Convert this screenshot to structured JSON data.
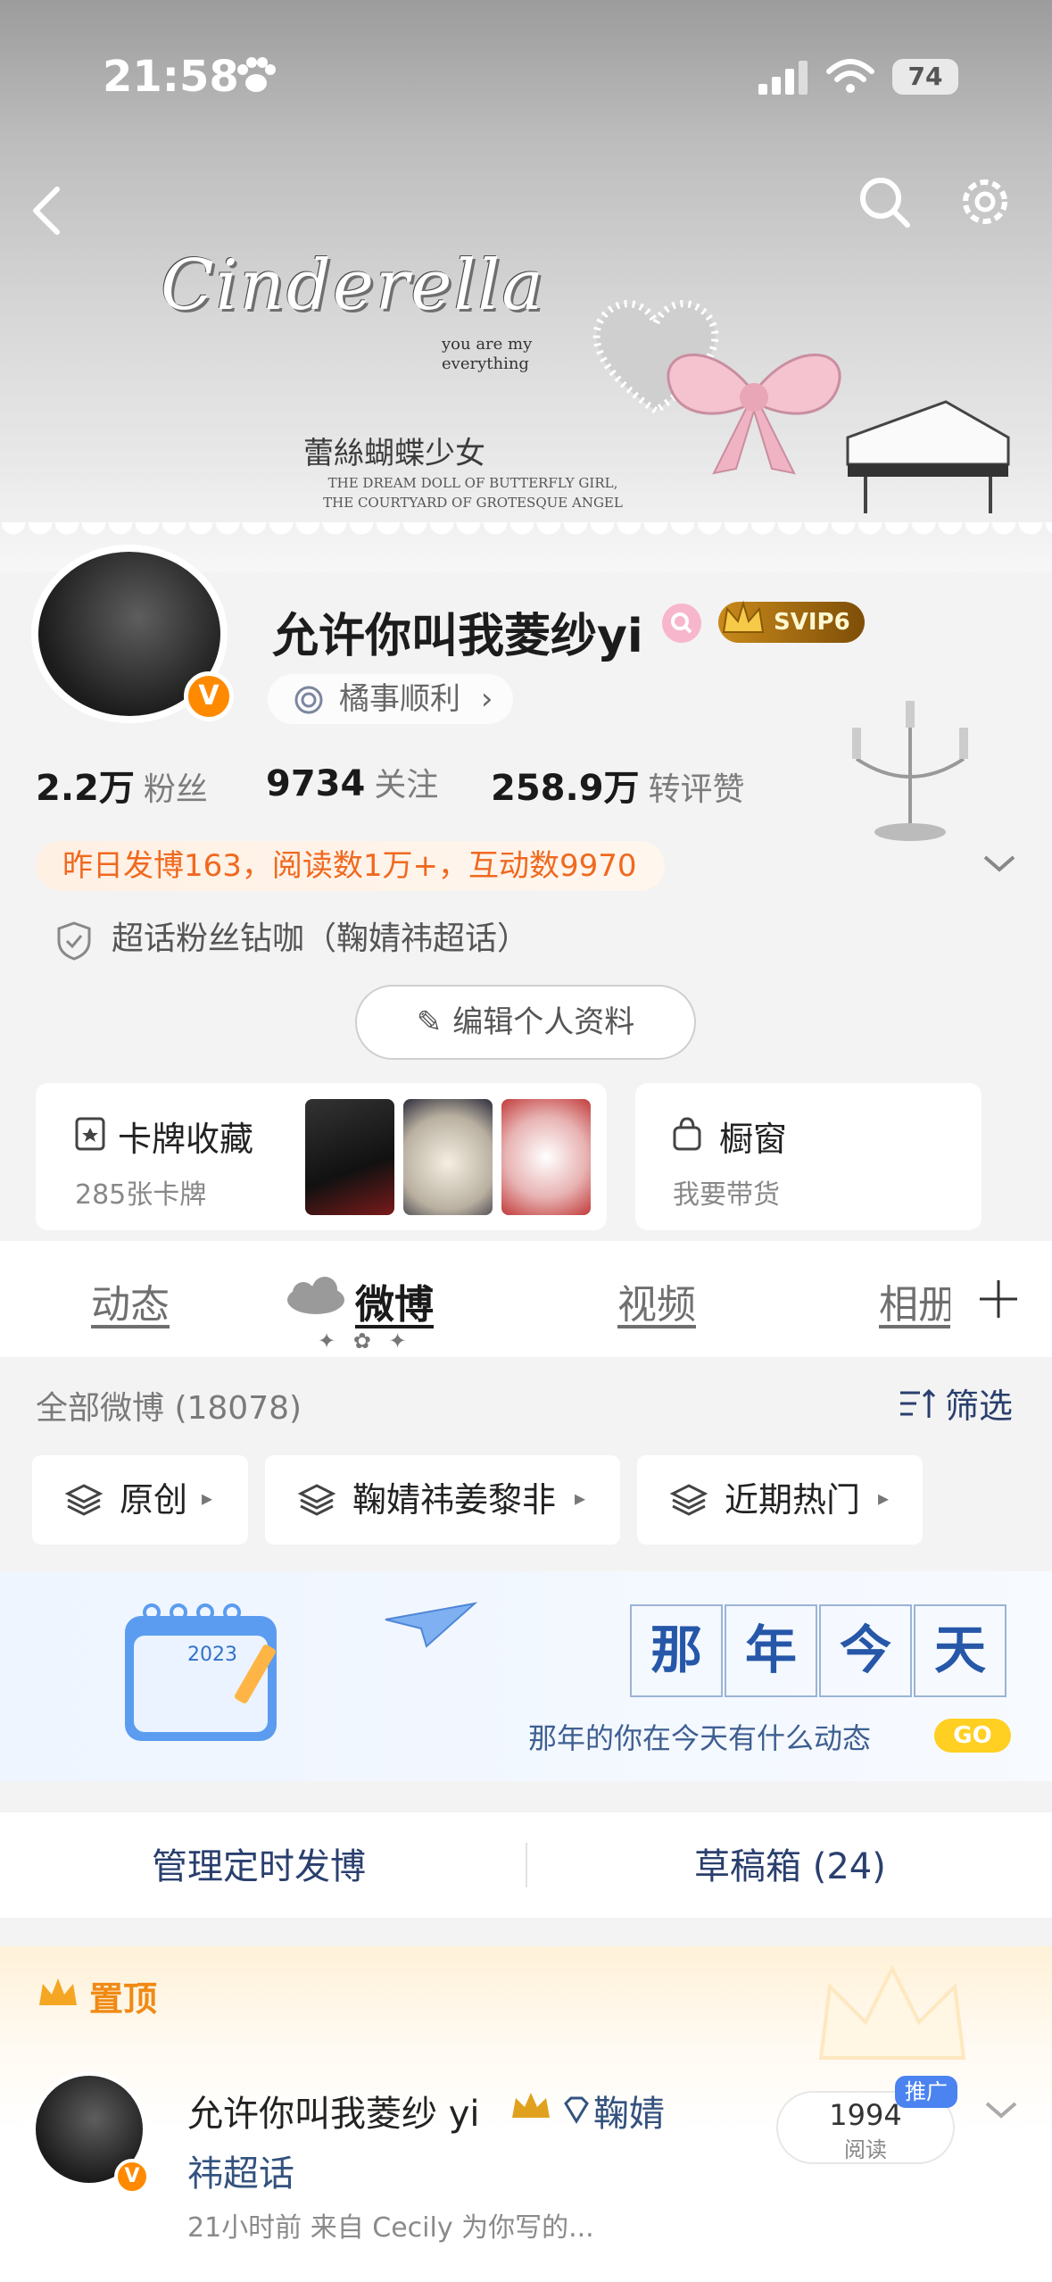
{
  "status_bar": {
    "time": "21:58",
    "battery": "74"
  },
  "banner": {
    "title_art": "Cinderella",
    "tagline": "you are my everything",
    "subtitle_cn": "蕾絲蝴蝶少女",
    "caption": "THE DREAM DOLL OF BUTTERFLY GIRL, THE COURTYARD OF GROTESQUE ANGEL"
  },
  "profile": {
    "nickname": "允许你叫我菱纱yi",
    "vip_label": "SVIP6",
    "verified_mark": "V",
    "wish_label": "橘事顺利",
    "stats": [
      {
        "value": "2.2万",
        "label": "粉丝"
      },
      {
        "value": "9734",
        "label": "关注"
      },
      {
        "value": "258.9万",
        "label": "转评赞"
      }
    ],
    "notice": "昨日发博163，阅读数1万+，互动数9970",
    "superfan": "超话粉丝钻咖（鞠婧祎超话）",
    "edit_button": "编辑个人资料"
  },
  "cards": {
    "collection_title": "卡牌收藏",
    "collection_sub": "285张卡牌",
    "shop_title": "橱窗",
    "shop_sub": "我要带货"
  },
  "tabs": [
    {
      "label": "动态"
    },
    {
      "label": "微博"
    },
    {
      "label": "视频"
    },
    {
      "label": "相册"
    }
  ],
  "feed": {
    "all_label": "全部微博 (18078)",
    "filter_label": "筛选",
    "chips": [
      "原创",
      "鞠婧祎姜黎非",
      "近期热门"
    ]
  },
  "memory": {
    "chars": [
      "那",
      "年",
      "今",
      "天"
    ],
    "subtitle": "那年的你在今天有什么动态",
    "go": "GO",
    "calendar_year": "2023"
  },
  "manage": {
    "scheduled": "管理定时发博",
    "drafts": "草稿箱 (24)"
  },
  "pinned": {
    "label": "置顶",
    "author": "允许你叫我菱纱 yi",
    "chaohua_a": "鞠婧",
    "chaohua_b": "祎超话",
    "meta": "21小时前  来自 Cecily 为你写的...",
    "read_count": "1994",
    "read_label": "阅读",
    "promo": "推广"
  },
  "colors": {
    "accent_orange": "#f0691f",
    "link_blue": "#2a3f6e",
    "vip_gold": "#c98a1b"
  }
}
